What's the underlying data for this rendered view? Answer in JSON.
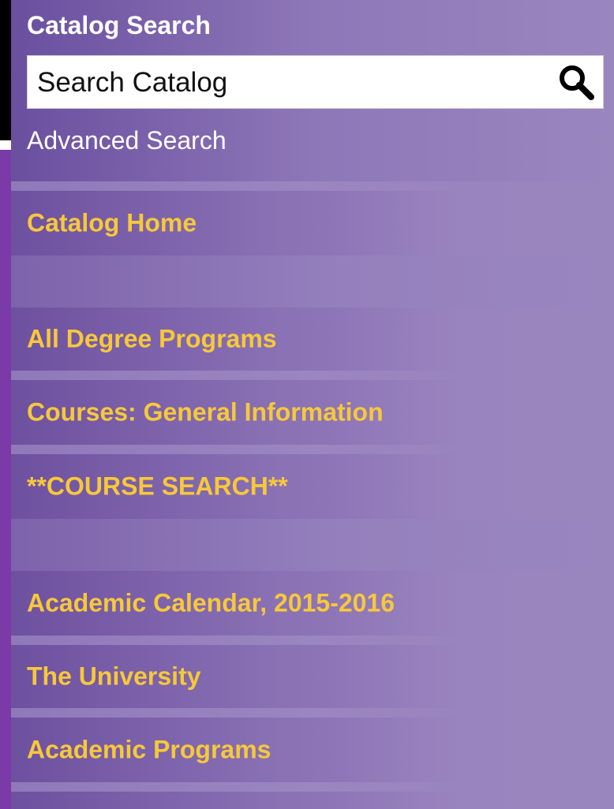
{
  "search": {
    "title": "Catalog Search",
    "placeholder": "Search Catalog",
    "advanced_label": "Advanced Search"
  },
  "nav": {
    "items": [
      {
        "label": "Catalog Home"
      },
      {
        "label": "All Degree Programs"
      },
      {
        "label": "Courses: General Information"
      },
      {
        "label": "**COURSE SEARCH**"
      },
      {
        "label": "Academic Calendar, 2015-2016"
      },
      {
        "label": "The University"
      },
      {
        "label": "Academic Programs"
      }
    ]
  },
  "colors": {
    "panel": "#8f79b9",
    "link_text": "#f7c83a",
    "title_text": "#ffffff"
  },
  "icons": {
    "search_button": "magnifier-icon"
  }
}
